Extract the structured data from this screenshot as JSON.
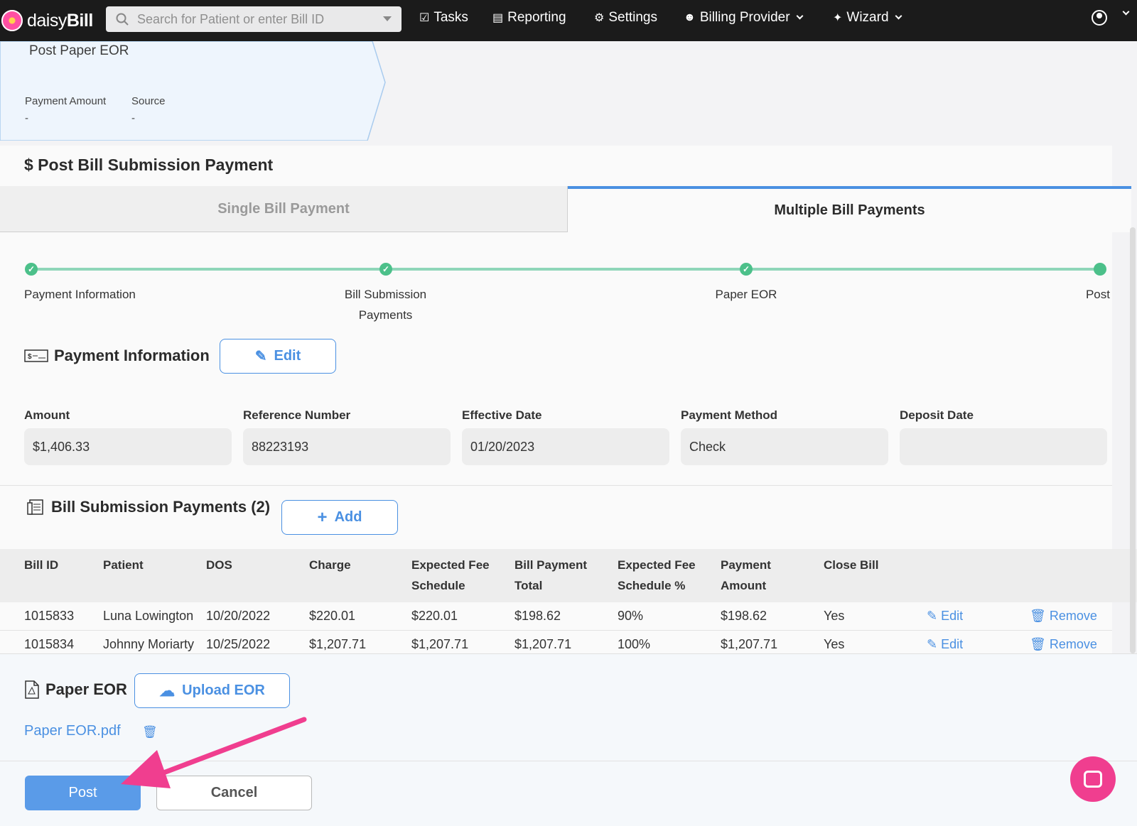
{
  "nav": {
    "brand_light": "daisy",
    "brand_bold": "Bill",
    "search_placeholder": "Search for Patient or enter Bill ID",
    "tasks": "Tasks",
    "reporting": "Reporting",
    "settings": "Settings",
    "billing_provider": "Billing Provider",
    "wizard": "Wizard"
  },
  "eor_card": {
    "title": "Post Paper EOR",
    "payment_amount_label": "Payment Amount",
    "payment_amount_value": "-",
    "source_label": "Source",
    "source_value": "-"
  },
  "section": {
    "title": "$ Post Bill Submission Payment",
    "tab_single": "Single Bill Payment",
    "tab_multi": "Multiple Bill Payments"
  },
  "steps": [
    {
      "label": "Payment Information",
      "done": true
    },
    {
      "label": "Bill Submission Payments",
      "done": true
    },
    {
      "label": "Paper EOR",
      "done": true
    },
    {
      "label": "Post",
      "done": false
    }
  ],
  "payment_info": {
    "title": "Payment Information",
    "edit_label": "Edit",
    "fields": [
      {
        "label": "Amount",
        "value": "$1,406.33"
      },
      {
        "label": "Reference Number",
        "value": "88223193"
      },
      {
        "label": "Effective Date",
        "value": "01/20/2023"
      },
      {
        "label": "Payment Method",
        "value": "Check"
      },
      {
        "label": "Deposit Date",
        "value": ""
      }
    ]
  },
  "bill_payments": {
    "title": "Bill Submission Payments (2)",
    "add_label": "Add",
    "columns": [
      "Bill ID",
      "Patient",
      "DOS",
      "Charge",
      "Expected Fee Schedule",
      "Bill Payment Total",
      "Expected Fee Schedule %",
      "Payment Amount",
      "Close Bill"
    ],
    "rows": [
      {
        "bill_id": "1015833",
        "patient": "Luna Lowington",
        "dos": "10/20/2022",
        "charge": "$220.01",
        "expected": "$220.01",
        "total": "$198.62",
        "pct": "90%",
        "payment": "$198.62",
        "close": "Yes",
        "edit": "Edit",
        "remove": "Remove"
      },
      {
        "bill_id": "1015834",
        "patient": "Johnny Moriarty",
        "dos": "10/25/2022",
        "charge": "$1,207.71",
        "expected": "$1,207.71",
        "total": "$1,207.71",
        "pct": "100%",
        "payment": "$1,207.71",
        "close": "Yes",
        "edit": "Edit",
        "remove": "Remove"
      }
    ]
  },
  "paper_eor": {
    "title": "Paper EOR",
    "upload_label": "Upload EOR",
    "file_name": "Paper EOR.pdf"
  },
  "actions": {
    "post": "Post",
    "cancel": "Cancel"
  },
  "colors": {
    "accent": "#4a90e2",
    "success": "#4cc08a",
    "highlight_arrow": "#f03e8f"
  }
}
